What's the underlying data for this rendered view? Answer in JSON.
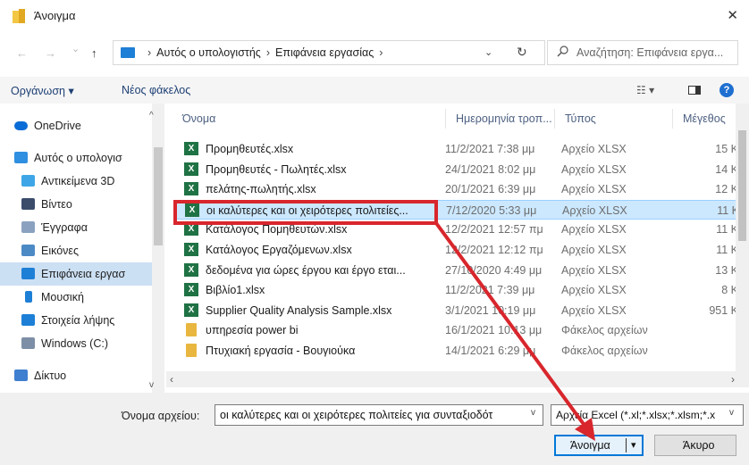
{
  "window": {
    "title": "Άνοιγμα",
    "close_glyph": "✕"
  },
  "address": {
    "back_glyph": "←",
    "forward_glyph": "→",
    "recent_glyph": "⌄",
    "up_glyph": "↑",
    "crumbs": [
      "Αυτός ο υπολογιστής",
      "Επιφάνεια εργασίας"
    ],
    "dropdown_glyph": "⌄",
    "refresh_glyph": "↻"
  },
  "search": {
    "placeholder": "Αναζήτηση: Επιφάνεια εργα..."
  },
  "toolbar": {
    "organize_label": "Οργάνωση ▾",
    "new_folder_label": "Νέος φάκελος",
    "view_glyph": "☷ ▾",
    "help_glyph": "?"
  },
  "sidebar": {
    "items": [
      {
        "label": "OneDrive",
        "icon": "cloud-icon",
        "color": "#0a6cd6"
      },
      {
        "label": "Αυτός ο υπολογισ",
        "icon": "computer-icon",
        "color": "#2f8fe0"
      },
      {
        "label": "Αντικείμενα 3D",
        "icon": "cube-icon",
        "color": "#3ea6e6"
      },
      {
        "label": "Βίντεο",
        "icon": "film-icon",
        "color": "#3a4c6a"
      },
      {
        "label": "Έγγραφα",
        "icon": "document-icon",
        "color": "#8aa2bf"
      },
      {
        "label": "Εικόνες",
        "icon": "picture-icon",
        "color": "#4c8ac6"
      },
      {
        "label": "Επιφάνεια εργασ",
        "icon": "desktop-icon",
        "color": "#1e7fd6",
        "selected": true
      },
      {
        "label": "Μουσική",
        "icon": "music-icon",
        "color": "#1e7fd6"
      },
      {
        "label": "Στοιχεία λήψης",
        "icon": "download-icon",
        "color": "#1e7fd6"
      },
      {
        "label": "Windows (C:)",
        "icon": "drive-icon",
        "color": "#7d8fa6"
      },
      {
        "label": "Δίκτυο",
        "icon": "network-icon",
        "color": "#3f7fcf"
      }
    ]
  },
  "columns": {
    "name": "Όνομα",
    "date": "Ημερομηνία τροπ...",
    "type": "Τύπος",
    "size": "Μέγεθος"
  },
  "files": [
    {
      "name": "Προμηθευτές.xlsx",
      "date": "11/2/2021 7:38 μμ",
      "type": "Αρχείο XLSX",
      "size": "15 K",
      "kind": "excel"
    },
    {
      "name": "Προμηθευτές - Πωλητές.xlsx",
      "date": "24/1/2021 8:02 μμ",
      "type": "Αρχείο XLSX",
      "size": "14 K",
      "kind": "excel"
    },
    {
      "name": "πελάτης-πωλητής.xlsx",
      "date": "20/1/2021 6:39 μμ",
      "type": "Αρχείο XLSX",
      "size": "12 K",
      "kind": "excel"
    },
    {
      "name": "οι καλύτερες και οι χειρότερες πολιτείες...",
      "date": "7/12/2020 5:33 μμ",
      "type": "Αρχείο XLSX",
      "size": "11 K",
      "kind": "excel",
      "selected": true
    },
    {
      "name": "Κατάλογος Πομηθευτών.xlsx",
      "date": "12/2/2021 12:57 πμ",
      "type": "Αρχείο XLSX",
      "size": "11 K",
      "kind": "excel"
    },
    {
      "name": "Κατάλογος Εργαζόμενων.xlsx",
      "date": "12/2/2021 12:12 πμ",
      "type": "Αρχείο XLSX",
      "size": "11 K",
      "kind": "excel"
    },
    {
      "name": "δεδομένα για ώρες έργου και έργο εται...",
      "date": "27/10/2020 4:49 μμ",
      "type": "Αρχείο XLSX",
      "size": "13 K",
      "kind": "excel"
    },
    {
      "name": "Βιβλίο1.xlsx",
      "date": "11/2/2021 7:39 μμ",
      "type": "Αρχείο XLSX",
      "size": "8 K",
      "kind": "excel"
    },
    {
      "name": "Supplier Quality Analysis Sample.xlsx",
      "date": "3/1/2021 10:19 μμ",
      "type": "Αρχείο XLSX",
      "size": "951 K",
      "kind": "excel"
    },
    {
      "name": "υπηρεσία power bi",
      "date": "16/1/2021 10:13 μμ",
      "type": "Φάκελος αρχείων",
      "size": "",
      "kind": "folder"
    },
    {
      "name": "Πτυχιακή εργασία - Βουγιούκα",
      "date": "14/1/2021 6:29 μμ",
      "type": "Φάκελος αρχείων",
      "size": "",
      "kind": "folder"
    }
  ],
  "footer": {
    "filename_label": "Όνομα αρχείου:",
    "filename_value": "οι καλύτερες και οι χειρότερες πολιτείες για συνταξιοδότ",
    "filetype_value": "Αρχεία Excel (*.xl;*.xlsx;*.xlsm;*.x",
    "open_label": "Άνοιγμα",
    "cancel_label": "Άκυρο"
  },
  "colors": {
    "annotation_red": "#d8262c",
    "excel_green": "#1f7244",
    "folder_yellow": "#e9b73f",
    "selection_blue": "#cce8ff"
  }
}
